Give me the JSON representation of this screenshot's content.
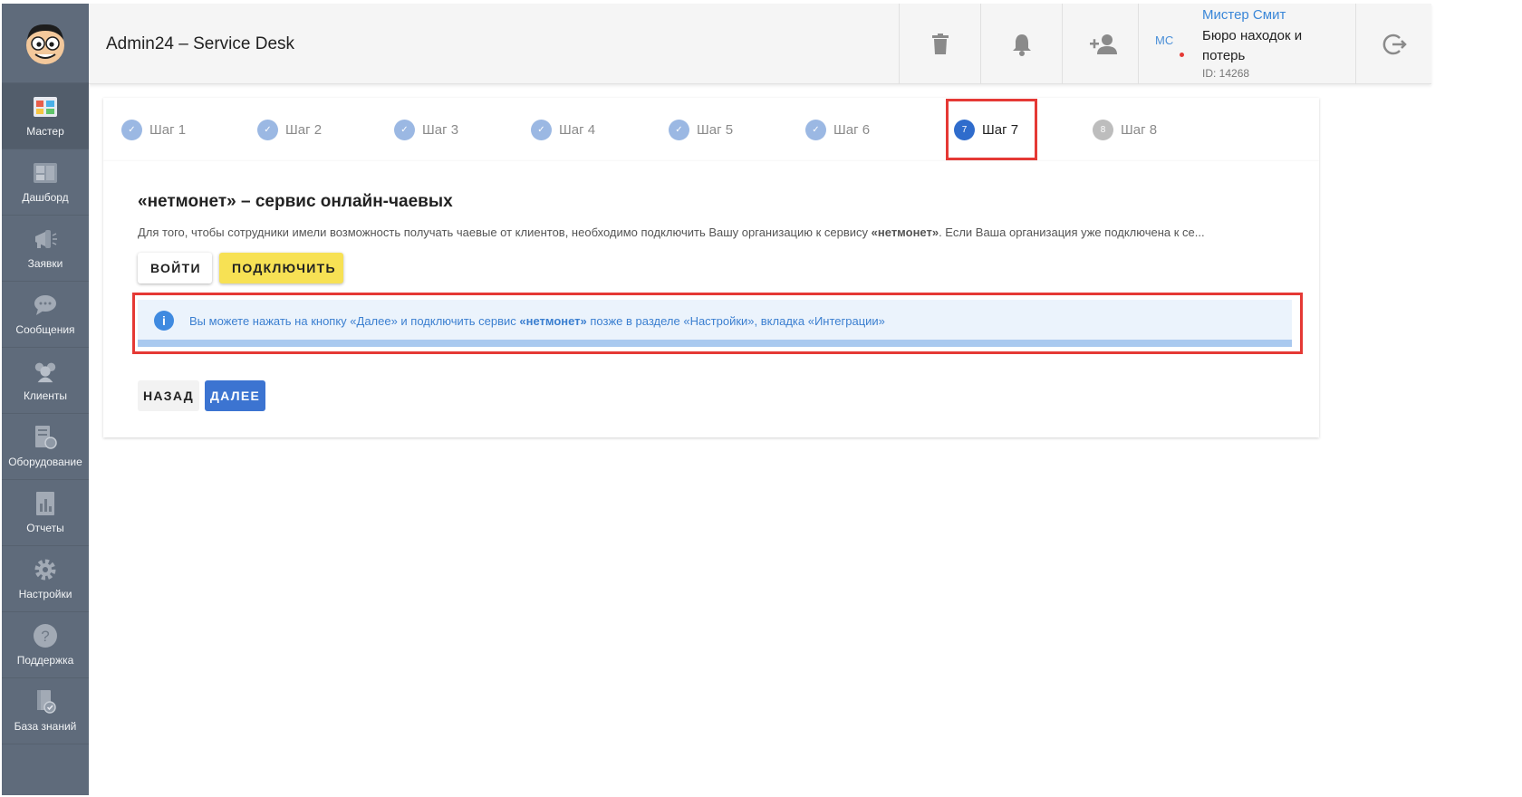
{
  "app": {
    "title": "Admin24 – Service Desk"
  },
  "sidebar": {
    "items": [
      {
        "label": "Мастер",
        "icon": "wizard-icon",
        "active": true
      },
      {
        "label": "Дашборд",
        "icon": "dashboard-icon"
      },
      {
        "label": "Заявки",
        "icon": "megaphone-icon"
      },
      {
        "label": "Сообщения",
        "icon": "chat-icon"
      },
      {
        "label": "Клиенты",
        "icon": "clients-icon"
      },
      {
        "label": "Оборудование",
        "icon": "equipment-icon"
      },
      {
        "label": "Отчеты",
        "icon": "reports-icon"
      },
      {
        "label": "Настройки",
        "icon": "gear-icon"
      },
      {
        "label": "Поддержка",
        "icon": "help-icon"
      },
      {
        "label": "База знаний",
        "icon": "knowledge-base-icon"
      }
    ]
  },
  "header": {
    "user": {
      "initials": "MC",
      "name": "Мистер Смит",
      "org": "Бюро находок и потерь",
      "id": "ID: 14268"
    }
  },
  "stepper": {
    "steps": [
      {
        "label": "Шаг 1",
        "state": "done"
      },
      {
        "label": "Шаг 2",
        "state": "done"
      },
      {
        "label": "Шаг 3",
        "state": "done"
      },
      {
        "label": "Шаг 4",
        "state": "done"
      },
      {
        "label": "Шаг 5",
        "state": "done"
      },
      {
        "label": "Шаг 6",
        "state": "done"
      },
      {
        "label": "Шаг 7",
        "state": "current",
        "number": "7"
      },
      {
        "label": "Шаг 8",
        "state": "todo",
        "number": "8"
      }
    ]
  },
  "card": {
    "title": "«нетмонет» – сервис онлайн-чаевых",
    "description": {
      "part1": "Для того, чтобы сотрудники имели возможность получать чаевые от клиентов, необходимо подключить Вашу организацию к сервису ",
      "bold": "«нетмонет»",
      "part2": ". Если Ваша организация уже подключена к се..."
    },
    "login_label": "ВОЙТИ",
    "connect_label": "ПОДКЛЮЧИТЬ",
    "info": {
      "part1": "Вы можете нажать на кнопку «Далее» и подключить сервис ",
      "bold": "«нетмонет»",
      "part2": " позже в разделе «Настройки», вкладка «Интеграции»"
    },
    "back_label": "НАЗАД",
    "next_label": "ДАЛЕЕ"
  },
  "colors": {
    "sidebar_bg": "#5f6b7b",
    "primary": "#3c74d1",
    "connect_yellow": "#f7e154",
    "highlight_red": "#e53935"
  }
}
